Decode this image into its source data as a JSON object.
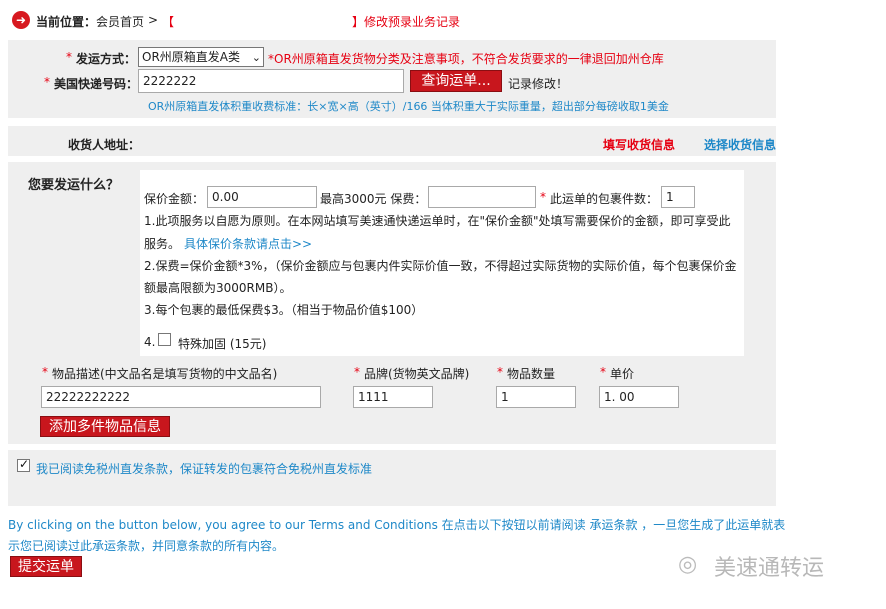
{
  "breadcrumb": {
    "label": "当前位置：",
    "home": "会员首页",
    "sep": ">",
    "bracket_open": "【",
    "bracket_close": "】",
    "current": "修改预录业务记录"
  },
  "shipping": {
    "method_label": "发运方式：",
    "method_value": "OR州原箱直发A类",
    "method_note": "*OR州原箱直发货物分类及注意事项，不符合发货要求的一律退回加州仓库",
    "tracking_label": "美国快递号码：",
    "tracking_value": "2222222",
    "query_button": "查询运单...",
    "record_edit": "记录修改！",
    "volume_note": "OR州原箱直发体积重收费标准：长×宽×高（英寸）/166 当体积重大于实际重量，超出部分每磅收取1美金"
  },
  "consignee": {
    "label": "收货人地址：",
    "fill_link": "填写收货信息",
    "select_link": "选择收货信息"
  },
  "cargo": {
    "question": "您要发运什么？",
    "insured_label": "保价金额：",
    "insured_value": "0.00",
    "max_premium": "最高3000元 保费：",
    "premium_value": "",
    "package_count_label": "此运单的包裹件数：",
    "package_count_value": "1",
    "rule1a": "1.此项服务以自愿为原则。在本网站填写美速通快递运单时，在\"保价金额\"处填写需要保价的金额，即可享受此",
    "rule1b": "服务。",
    "rule1_link": "具体保价条款请点击>>",
    "rule2a": "2.保费=保价金额*3%，（保价金额应与包裹内件实际价值一致，不得超过实际货物的实际价值，每个包裹保价金",
    "rule2b": "额最高限额为3000RMB）。",
    "rule3": "3.每个包裹的最低保费$3。（相当于物品价值$100）",
    "rule4_num": "4.",
    "rule4_label": "特殊加固 (15元)"
  },
  "items": {
    "desc_label": "物品描述(中文品名是填写货物的中文品名)",
    "brand_label": "品牌(货物英文品牌)",
    "qty_label": "物品数量",
    "price_label": "单价",
    "desc_value": "22222222222",
    "brand_value": "1111",
    "qty_value": "1",
    "price_value": "1. 00",
    "add_button": "添加多件物品信息"
  },
  "agreement": {
    "checkbox_text": "我已阅读免税州直发条款，保证转发的包裹符合免税州直发标准"
  },
  "terms": {
    "line1": "By clicking on the button below, you agree to our Terms and Conditions 在点击以下按钮以前请阅读 承运条款 ，一旦您生成了此运单就表",
    "line2": "示您已阅读过此承运条款，并同意条款的所有内容。"
  },
  "submit_button": "提交运单",
  "watermark": "美速通转运",
  "colors": {
    "red": "#e60012",
    "blue": "#1e88c8",
    "panel": "#efefef",
    "button": "#c8161d"
  }
}
